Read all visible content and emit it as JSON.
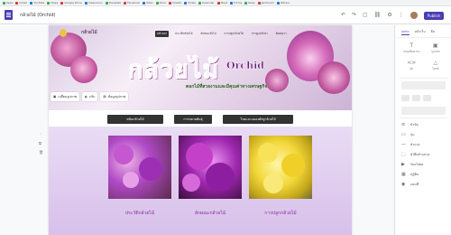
{
  "bookmarks": [
    "Apps",
    "Gmail",
    "YouTube",
    "Maps",
    "Google Drive",
    "Classroom",
    "Translate",
    "Facebook",
    "Sites",
    "Docs",
    "Sheets",
    "Slides",
    "Calendar",
    "Meet",
    "Forms",
    "Keep",
    "Jamboard",
    "Others"
  ],
  "app": {
    "title": "กล้วยไม้ (Orchid)",
    "publish_label": "Publish"
  },
  "toolbar": {
    "undo": "↶",
    "redo": "↷",
    "preview": "▢",
    "link": "⛓",
    "settings": "⚙",
    "more": "⋮"
  },
  "site": {
    "name": "กล้วยไม้",
    "nav": [
      "หน้าแรก",
      "ประวัติกล้วยไม้",
      "ลักษณะทั่วไป",
      "การปลูกกล้วยไม้",
      "การดูแลรักษา",
      "ติดต่อเรา"
    ],
    "hero_title": "กล้วยไม้",
    "hero_en": "Orchid",
    "subtitle": "ดอกไม้ที่สวยงามและมีคุณค่าทางเศรษฐกิจ",
    "header_buttons": [
      "เปลี่ยนรูปภาพ",
      "ปรับ",
      "ข้อมูลรูปภาพ"
    ]
  },
  "menu_buttons": [
    "ชนิดกล้วยไม้",
    "การขยายพันธุ์",
    "โรคและแมลงศัตรูกล้วยไม้"
  ],
  "gallery": [
    {
      "caption": "ประวัติกล้วยไม้"
    },
    {
      "caption": "ลักษณะกล้วยไม้"
    },
    {
      "caption": "การปลูกกล้วยไม้"
    }
  ],
  "right_panel": {
    "tabs": [
      "แทรก",
      "หน้าเว็บ",
      "ธีม"
    ],
    "insert_cells": [
      "กล่องข้อความ",
      "รูปภาพ",
      "ฝัง",
      "ไดรฟ์"
    ],
    "list_items": [
      "หัวข้อ",
      "ปุ่ม",
      "ตัวแบ่ง",
      "ตัวยึดตำแหน่ง",
      "YouTube",
      "ปฏิทิน",
      "แผนที่"
    ]
  }
}
